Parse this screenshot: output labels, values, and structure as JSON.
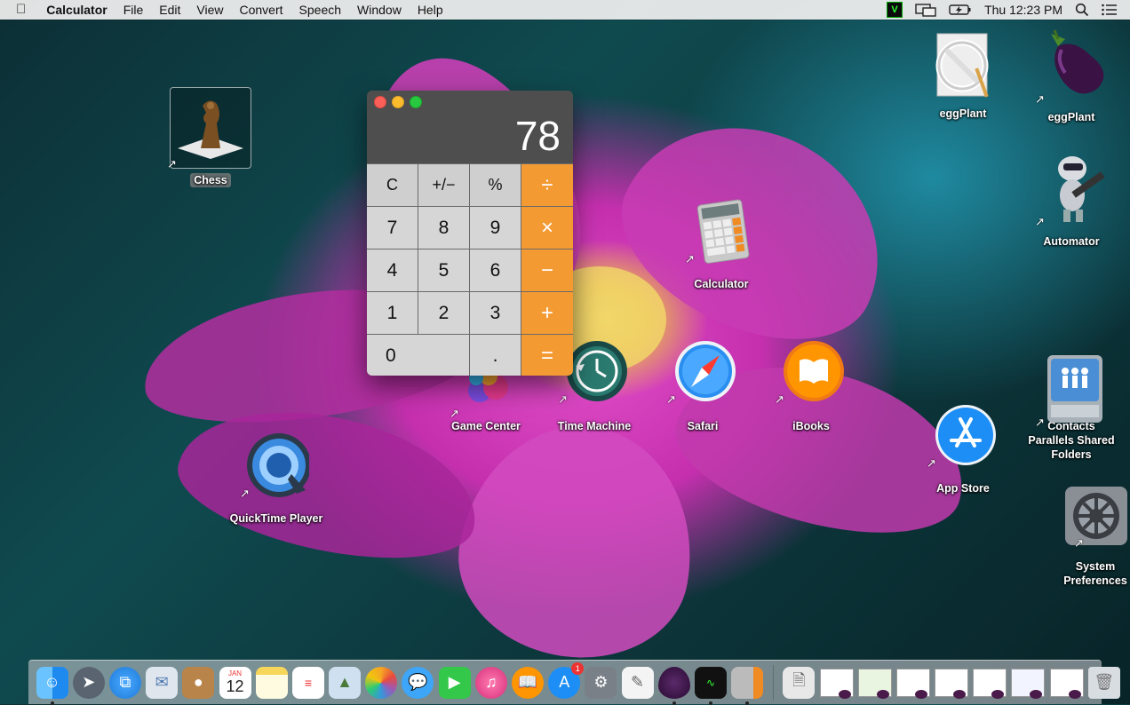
{
  "menubar": {
    "app_name": "Calculator",
    "items": [
      "File",
      "Edit",
      "View",
      "Convert",
      "Speech",
      "Window",
      "Help"
    ],
    "clock": "Thu 12:23 PM",
    "status_icons": [
      "vnc-icon",
      "display-mirror-icon",
      "battery-charging-icon",
      "spotlight-icon",
      "notification-center-icon"
    ]
  },
  "calculator": {
    "display": "78",
    "keys": [
      {
        "label": "C",
        "kind": "fn"
      },
      {
        "label": "+/−",
        "kind": "fn"
      },
      {
        "label": "%",
        "kind": "fn"
      },
      {
        "label": "÷",
        "kind": "op"
      },
      {
        "label": "7",
        "kind": "num"
      },
      {
        "label": "8",
        "kind": "num"
      },
      {
        "label": "9",
        "kind": "num"
      },
      {
        "label": "×",
        "kind": "op"
      },
      {
        "label": "4",
        "kind": "num"
      },
      {
        "label": "5",
        "kind": "num"
      },
      {
        "label": "6",
        "kind": "num"
      },
      {
        "label": "−",
        "kind": "op"
      },
      {
        "label": "1",
        "kind": "num"
      },
      {
        "label": "2",
        "kind": "num"
      },
      {
        "label": "3",
        "kind": "num"
      },
      {
        "label": "+",
        "kind": "op"
      },
      {
        "label": "0",
        "kind": "num"
      },
      {
        "label": ".",
        "kind": "num"
      },
      {
        "label": "=",
        "kind": "op"
      }
    ]
  },
  "desktop": {
    "icons": [
      {
        "label": "Chess",
        "icon": "chess-icon"
      },
      {
        "label": "eggPlant",
        "icon": "eggplant-prohibited-icon"
      },
      {
        "label": "eggPlant",
        "icon": "eggplant-icon"
      },
      {
        "label": "Automator",
        "icon": "automator-icon"
      },
      {
        "label": "Calculator",
        "icon": "calculator-icon"
      },
      {
        "label": "Game Center",
        "icon": "game-center-icon"
      },
      {
        "label": "Time Machine",
        "icon": "time-machine-icon"
      },
      {
        "label": "Safari",
        "icon": "safari-icon"
      },
      {
        "label": "iBooks",
        "icon": "ibooks-icon"
      },
      {
        "label": "Contacts\nParallels Shared\nFolders",
        "icon": "shared-folders-icon"
      },
      {
        "label": "App Store",
        "icon": "app-store-icon"
      },
      {
        "label": "QuickTime Player",
        "icon": "quicktime-icon"
      },
      {
        "label": "System\nPreferences",
        "icon": "system-preferences-icon"
      }
    ]
  },
  "dock": {
    "apps": [
      "finder-icon",
      "launchpad-icon",
      "safari-icon",
      "mail-icon",
      "contacts-icon",
      "calendar-icon",
      "notes-icon",
      "reminders-icon",
      "preview-icon",
      "photos-icon",
      "messages-icon",
      "facetime-icon",
      "itunes-icon",
      "ibooks-icon",
      "app-store-icon",
      "system-preferences-icon",
      "textedit-icon",
      "eggplant-icon",
      "activity-monitor-icon",
      "calculator-icon"
    ],
    "calendar_month": "JAN",
    "calendar_day": "12",
    "app_store_badge": "1",
    "minimized_count": 8
  }
}
